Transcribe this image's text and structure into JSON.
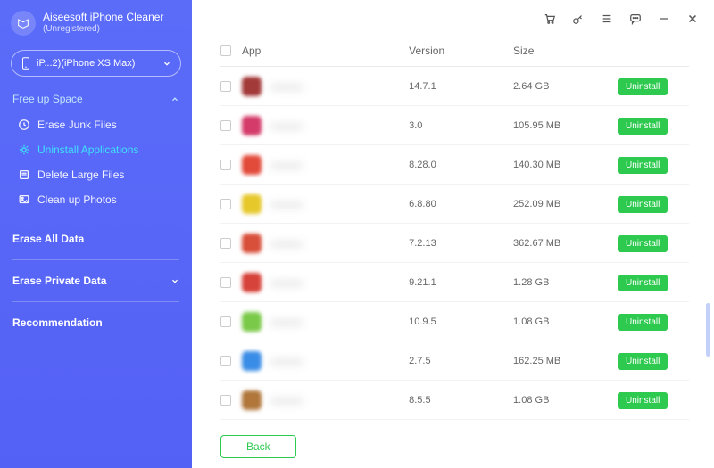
{
  "brand": {
    "title": "Aiseesoft iPhone",
    "subtitle": "Cleaner",
    "status": "(Unregistered)"
  },
  "device": {
    "label": "iP...2)(iPhone XS Max)"
  },
  "nav": {
    "freeUpSpace": "Free up Space",
    "items": [
      {
        "label": "Erase Junk Files"
      },
      {
        "label": "Uninstall Applications"
      },
      {
        "label": "Delete Large Files"
      },
      {
        "label": "Clean up Photos"
      }
    ],
    "eraseAll": "Erase All Data",
    "erasePrivate": "Erase Private Data",
    "recommendation": "Recommendation"
  },
  "columns": {
    "app": "App",
    "version": "Version",
    "size": "Size"
  },
  "uninstallLabel": "Uninstall",
  "backLabel": "Back",
  "apps": [
    {
      "name": "",
      "version": "14.7.1",
      "size": "2.64 GB",
      "color": "#a33a3a"
    },
    {
      "name": "",
      "version": "3.0",
      "size": "105.95 MB",
      "color": "#d43b6a"
    },
    {
      "name": "",
      "version": "8.28.0",
      "size": "140.30 MB",
      "color": "#e24a3a"
    },
    {
      "name": "",
      "version": "6.8.80",
      "size": "252.09 MB",
      "color": "#e6c82a"
    },
    {
      "name": "",
      "version": "7.2.13",
      "size": "362.67 MB",
      "color": "#d84f3a"
    },
    {
      "name": "",
      "version": "9.21.1",
      "size": "1.28 GB",
      "color": "#d6433a"
    },
    {
      "name": "",
      "version": "10.9.5",
      "size": "1.08 GB",
      "color": "#7ac948"
    },
    {
      "name": "",
      "version": "2.7.5",
      "size": "162.25 MB",
      "color": "#3a8de6"
    },
    {
      "name": "",
      "version": "8.5.5",
      "size": "1.08 GB",
      "color": "#b0763a"
    }
  ],
  "colors": {
    "accent": "#3ee2ff",
    "primary": "#5461f5",
    "success": "#2ec94f"
  }
}
